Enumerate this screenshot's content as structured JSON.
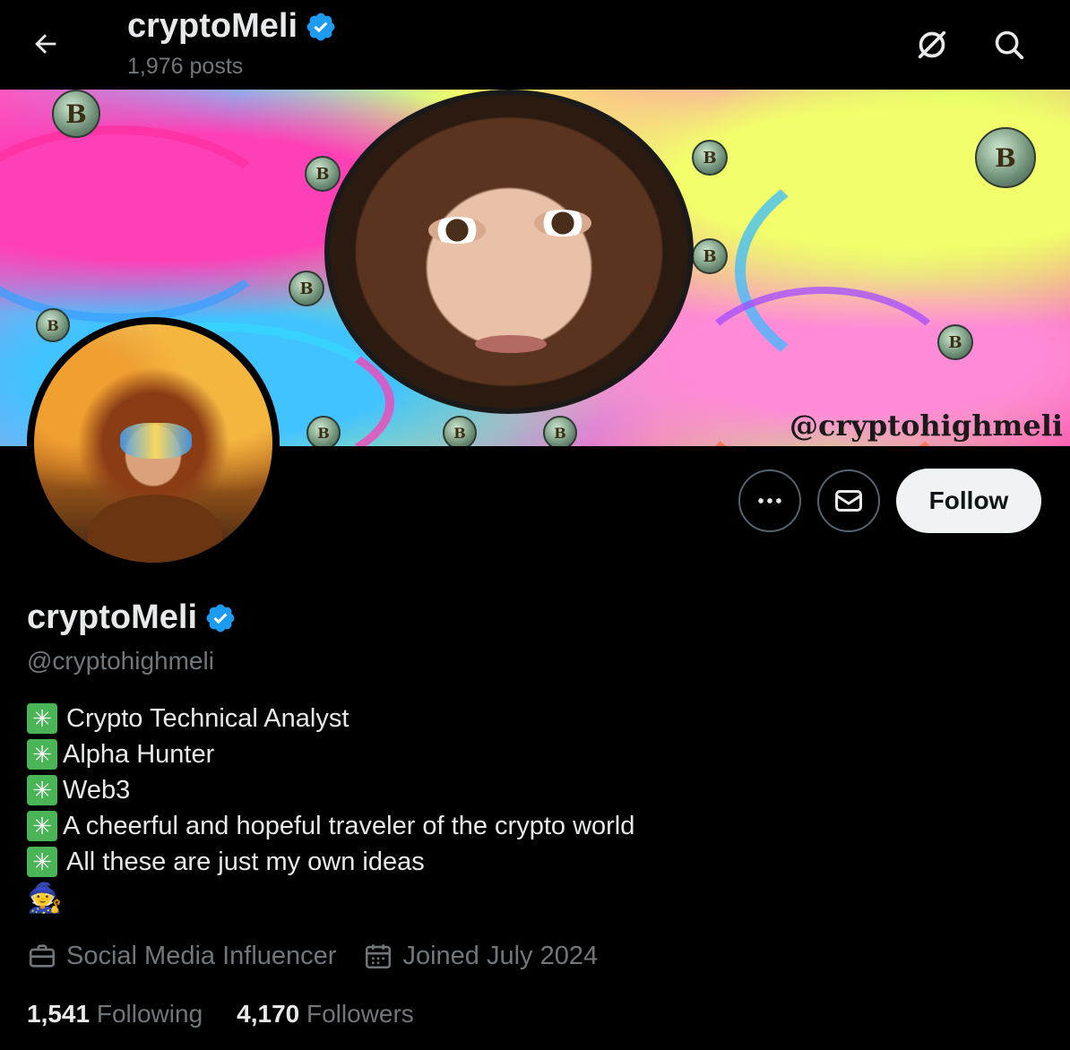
{
  "header": {
    "title": "cryptoMeli",
    "posts": "1,976 posts"
  },
  "icons": {
    "back": "arrow-left-icon",
    "grok": "grok-icon",
    "search": "search-icon",
    "verified": "verified-badge-icon",
    "more": "more-icon",
    "message": "mail-icon",
    "briefcase": "briefcase-icon",
    "calendar": "calendar-icon"
  },
  "banner": {
    "watermark": "@cryptohighmeli"
  },
  "actions": {
    "follow_label": "Follow"
  },
  "profile": {
    "display_name": "cryptoMeli",
    "handle": "@cryptohighmeli",
    "bio": [
      "Crypto Technical Analyst",
      "Alpha Hunter",
      "Web3",
      "A cheerful and hopeful traveler of the crypto world",
      "All these are just my own ideas"
    ],
    "bio_emoji": "🧙",
    "category": "Social Media Influencer",
    "joined": "Joined July 2024"
  },
  "stats": {
    "following_count": "1,541",
    "following_label": "Following",
    "followers_count": "4,170",
    "followers_label": "Followers"
  },
  "colors": {
    "background": "#000000",
    "text": "#e7e9ea",
    "muted": "#71767b",
    "verified": "#1d9bf0",
    "follow_bg": "#eff3f4"
  }
}
